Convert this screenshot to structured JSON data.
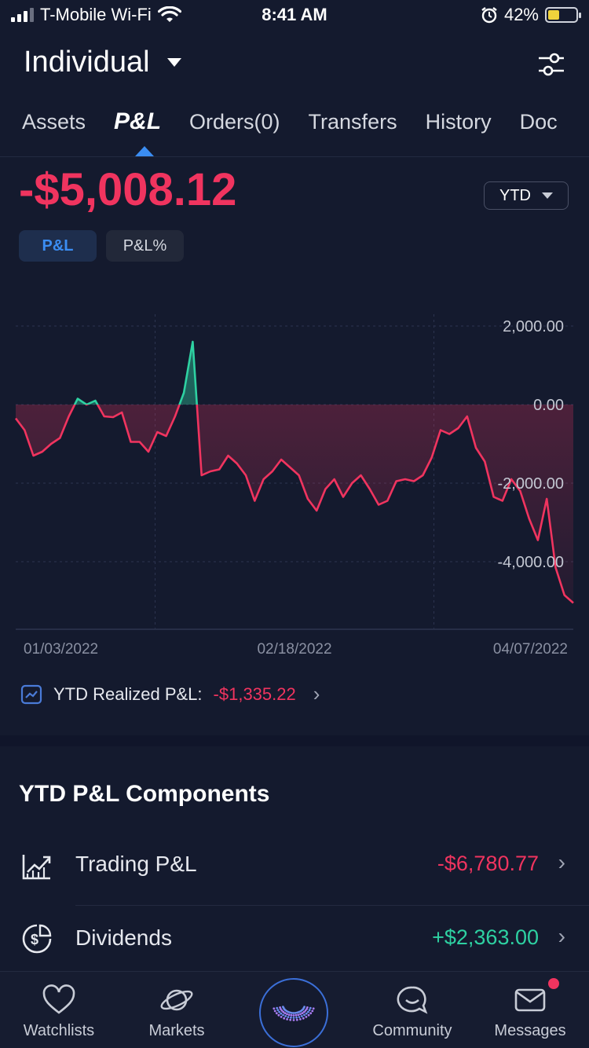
{
  "status_bar": {
    "carrier": "T-Mobile Wi-Fi",
    "time": "8:41 AM",
    "battery": "42%",
    "battery_level": 0.42
  },
  "header": {
    "account": "Individual"
  },
  "tabs": [
    {
      "label": "Assets",
      "active": false
    },
    {
      "label": "P&L",
      "active": true
    },
    {
      "label": "Orders(0)",
      "active": false
    },
    {
      "label": "Transfers",
      "active": false
    },
    {
      "label": "History",
      "active": false
    },
    {
      "label": "Doc",
      "active": false
    }
  ],
  "pnl": {
    "value": "-$5,008.12",
    "period": "YTD",
    "toggle_pnl": "P&L",
    "toggle_pct": "P&L%"
  },
  "chart_data": {
    "type": "area",
    "x_tick_labels": [
      "01/03/2022",
      "02/18/2022",
      "04/07/2022"
    ],
    "y_tick_labels": [
      "2,000.00",
      "0.00",
      "-2,000.00",
      "-4,000.00"
    ],
    "ylim": [
      -5700,
      2300
    ],
    "y_ticks": [
      2000,
      0,
      -2000,
      -4000
    ],
    "values": [
      -350,
      -650,
      -1300,
      -1200,
      -1000,
      -850,
      -300,
      150,
      0,
      100,
      -300,
      -320,
      -200,
      -950,
      -950,
      -1200,
      -700,
      -800,
      -300,
      300,
      1600,
      -1800,
      -1700,
      -1650,
      -1300,
      -1500,
      -1800,
      -2450,
      -1900,
      -1700,
      -1400,
      -1600,
      -1800,
      -2400,
      -2700,
      -2150,
      -1900,
      -2350,
      -2000,
      -1800,
      -2150,
      -2550,
      -2450,
      -1950,
      -1900,
      -1950,
      -1800,
      -1350,
      -650,
      -750,
      -600,
      -300,
      -1100,
      -1450,
      -2350,
      -2450,
      -1900,
      -2200,
      -2900,
      -3450,
      -2400,
      -4150,
      -4850,
      -5050
    ],
    "positive_color": "#2ed1a2",
    "negative_color": "#f0345f",
    "grid": true
  },
  "realized": {
    "label": "YTD Realized P&L:",
    "value": "-$1,335.22"
  },
  "components": {
    "title": "YTD P&L Components",
    "rows": [
      {
        "label": "Trading P&L",
        "value": "-$6,780.77",
        "color": "#f0345f",
        "icon": "chart-up-icon"
      },
      {
        "label": "Dividends",
        "value": "+$2,363.00",
        "color": "#2ed1a2",
        "icon": "dividend-icon"
      }
    ]
  },
  "nav": [
    {
      "label": "Watchlists",
      "icon": "heart-icon"
    },
    {
      "label": "Markets",
      "icon": "planet-icon"
    },
    {
      "label": "Community",
      "icon": "chat-icon"
    },
    {
      "label": "Messages",
      "icon": "mail-icon"
    }
  ]
}
